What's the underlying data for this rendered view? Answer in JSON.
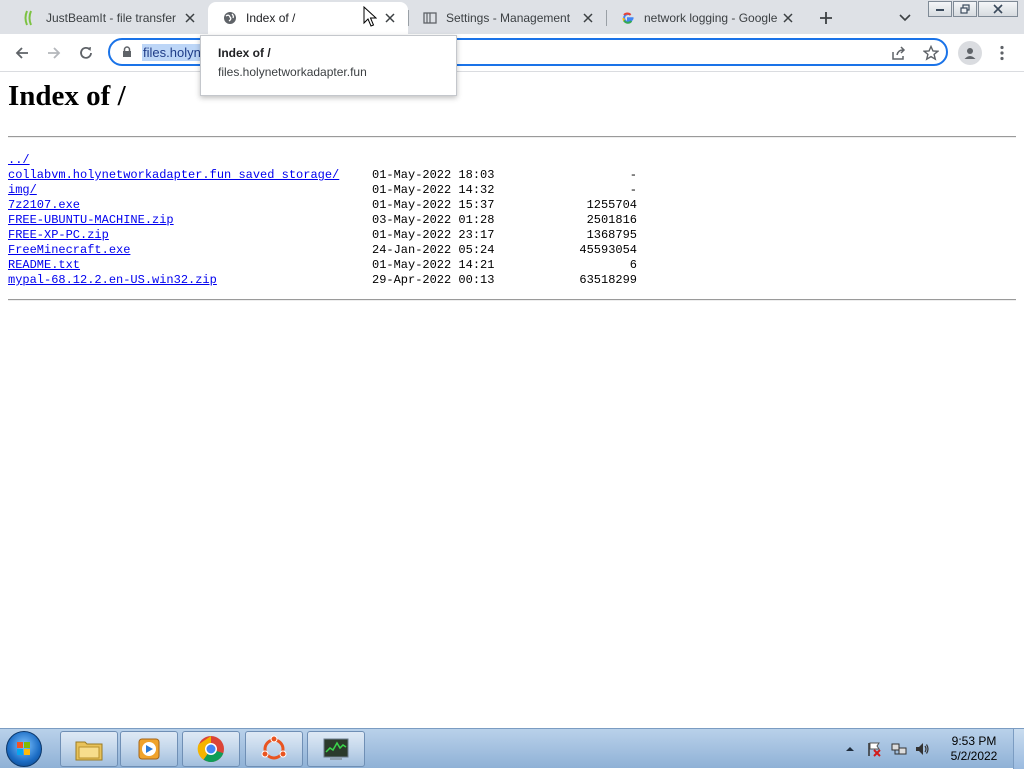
{
  "tabs": [
    {
      "title": "JustBeamIt - file transfer",
      "favicon": "justbeamit-icon",
      "active": false
    },
    {
      "title": "Index of /",
      "favicon": "globe-icon",
      "active": true
    },
    {
      "title": "Settings - Management",
      "favicon": "settings-page-icon",
      "active": false
    },
    {
      "title": "network logging - Google",
      "favicon": "google-icon",
      "active": false
    }
  ],
  "omnibox": {
    "url": "files.holyn"
  },
  "tooltip": {
    "title": "Index of /",
    "host": "files.holynetworkadapter.fun"
  },
  "page": {
    "heading": "Index of /",
    "parent_link": "../",
    "entries": [
      {
        "name": "collabvm.holynetworkadapter.fun saved storage/",
        "date": "01-May-2022 18:03",
        "size": "-"
      },
      {
        "name": "img/",
        "date": "01-May-2022 14:32",
        "size": "-"
      },
      {
        "name": "7z2107.exe",
        "date": "01-May-2022 15:37",
        "size": "1255704"
      },
      {
        "name": "FREE-UBUNTU-MACHINE.zip",
        "date": "03-May-2022 01:28",
        "size": "2501816"
      },
      {
        "name": "FREE-XP-PC.zip",
        "date": "01-May-2022 23:17",
        "size": "1368795"
      },
      {
        "name": "FreeMinecraft.exe",
        "date": "24-Jan-2022 05:24",
        "size": "45593054"
      },
      {
        "name": "README.txt",
        "date": "01-May-2022 14:21",
        "size": "6"
      },
      {
        "name": "mypal-68.12.2.en-US.win32.zip",
        "date": "29-Apr-2022 00:13",
        "size": "63518299"
      }
    ]
  },
  "taskbar": {
    "pinned": [
      "file-explorer-icon",
      "media-player-icon",
      "chrome-icon",
      "ubuntu-icon",
      "task-manager-icon"
    ],
    "clock_time": "9:53 PM",
    "clock_date": "5/2/2022"
  },
  "colors": {
    "accent": "#1a73e8",
    "link": "#0000ee",
    "tabstrip": "#dee1e6"
  }
}
